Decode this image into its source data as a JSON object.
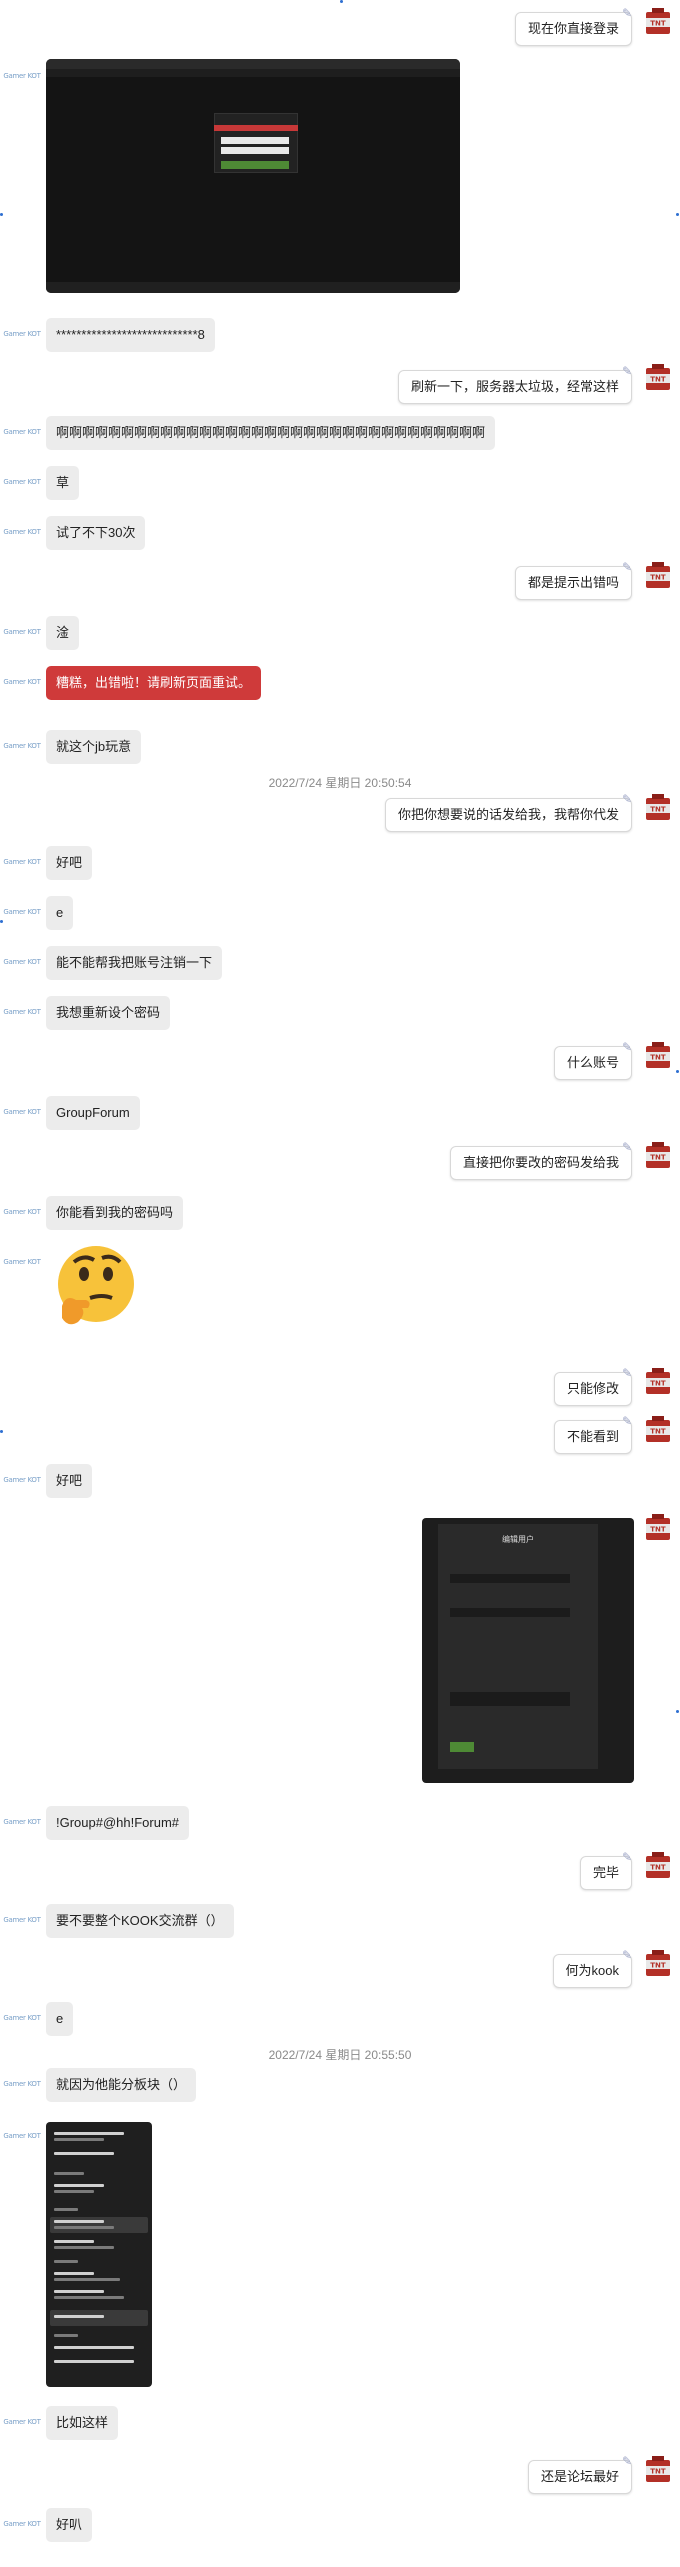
{
  "other_avatar_text": "Gamer KOT",
  "timestamps": [
    "2022/7/24 星期日 20:50:54",
    "2022/7/24 星期日 20:55:50"
  ],
  "messages": [
    {
      "text": "现在你直接登录"
    },
    {
      "text": "****************************8"
    },
    {
      "text": "刷新一下，服务器太垃圾，经常这样"
    },
    {
      "text": "啊啊啊啊啊啊啊啊啊啊啊啊啊啊啊啊啊啊啊啊啊啊啊啊啊啊啊啊啊啊啊啊啊"
    },
    {
      "text": "草"
    },
    {
      "text": "试了不下30次"
    },
    {
      "text": "都是提示出错吗"
    },
    {
      "text": "淦"
    },
    {
      "text": "糟糕，出错啦！请刷新页面重试。"
    },
    {
      "text": "就这个jb玩意"
    },
    {
      "text": "你把你想要说的话发给我，我帮你代发"
    },
    {
      "text": "好吧"
    },
    {
      "text": "e"
    },
    {
      "text": "能不能帮我把账号注销一下"
    },
    {
      "text": "我想重新设个密码"
    },
    {
      "text": "什么账号"
    },
    {
      "text": "GroupForum"
    },
    {
      "text": "直接把你要改的密码发给我"
    },
    {
      "text": "你能看到我的密码吗"
    },
    {
      "text": "只能修改"
    },
    {
      "text": "不能看到"
    },
    {
      "text": "好吧"
    },
    {
      "text": "!Group#@hh!Forum#"
    },
    {
      "text": "完毕"
    },
    {
      "text": "要不要整个KOOK交流群（）"
    },
    {
      "text": "何为kook"
    },
    {
      "text": "e"
    },
    {
      "text": "就因为他能分板块（）"
    },
    {
      "text": "比如这样"
    },
    {
      "text": "还是论坛最好"
    },
    {
      "text": "好叭"
    }
  ],
  "screenshot2": {
    "title": "编辑用户"
  },
  "colors": {
    "error_bubble": "#cf3a3a",
    "me_avatar": "#c0392b",
    "bubble_left": "#ececec"
  }
}
